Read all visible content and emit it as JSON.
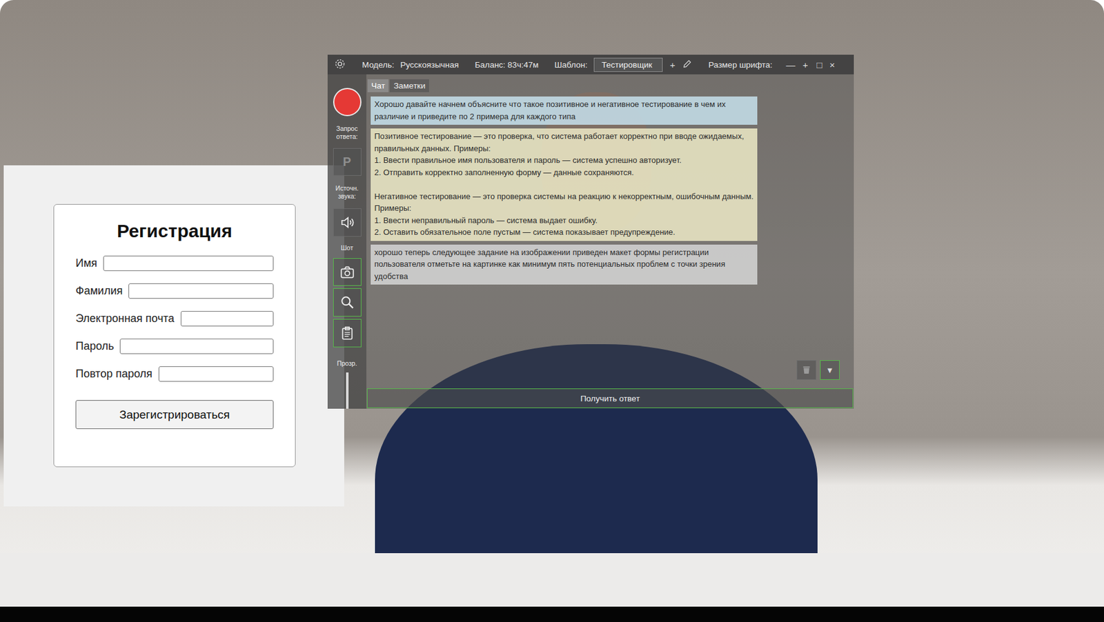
{
  "form": {
    "title": "Регистрация",
    "fields": [
      {
        "label": "Имя"
      },
      {
        "label": "Фамилия"
      },
      {
        "label": "Электронная почта"
      },
      {
        "label": "Пароль"
      },
      {
        "label": "Повтор пароля"
      }
    ],
    "button": "Зарегистрироваться"
  },
  "app": {
    "title_bar": {
      "model_label": "Модель:",
      "model": "Русскоязычная",
      "balance": "Баланс: 83ч:47м",
      "template_label": "Шаблон:",
      "template": "Тестировщик",
      "add": "+",
      "font_size_label": "Размер шрифта:",
      "font_controls": [
        "—",
        "+"
      ],
      "window_controls": [
        "□",
        "×"
      ]
    },
    "toolbar": {
      "record": {
        "label": "Запрос ответа:",
        "recording": true
      },
      "source_key": "P",
      "source_label": "Источн. звука:",
      "shot_label": "Шот",
      "opacity_label": "Прозр."
    },
    "tabs": [
      {
        "label": "Чат",
        "selected": true
      },
      {
        "label": "Заметки",
        "selected": false
      }
    ],
    "messages": [
      {
        "kind": "asked",
        "text": "Хорошо давайте начнем объясните что такое позитивное и негативное тестирование в чем их различие и приведите по 2 примера для каждого типа"
      },
      {
        "kind": "answer",
        "text": "Позитивное тестирование — это проверка, что система работает корректно при вводе ожидаемых, правильных данных. Примеры:\n1. Ввести правильное имя пользователя и пароль — система успешно авторизует.\n2. Отправить корректно заполненную форму — данные сохраняются.\n\nНегативное тестирование — это проверка системы на реакцию к некорректным, ошибочным данным. Примеры:\n1. Ввести неправильный пароль — система выдает ошибку.\n2. Оставить обязательное поле пустым — система показывает предупреждение."
      },
      {
        "kind": "pending",
        "text": "хорошо теперь следующее задание на изображении приведен макет формы регистрации пользователя отметьте на картинке как минимум пять потенциальных проблем с точки зрения удобства"
      }
    ],
    "dropdown": "▼",
    "get_answer": "Получить ответ"
  }
}
